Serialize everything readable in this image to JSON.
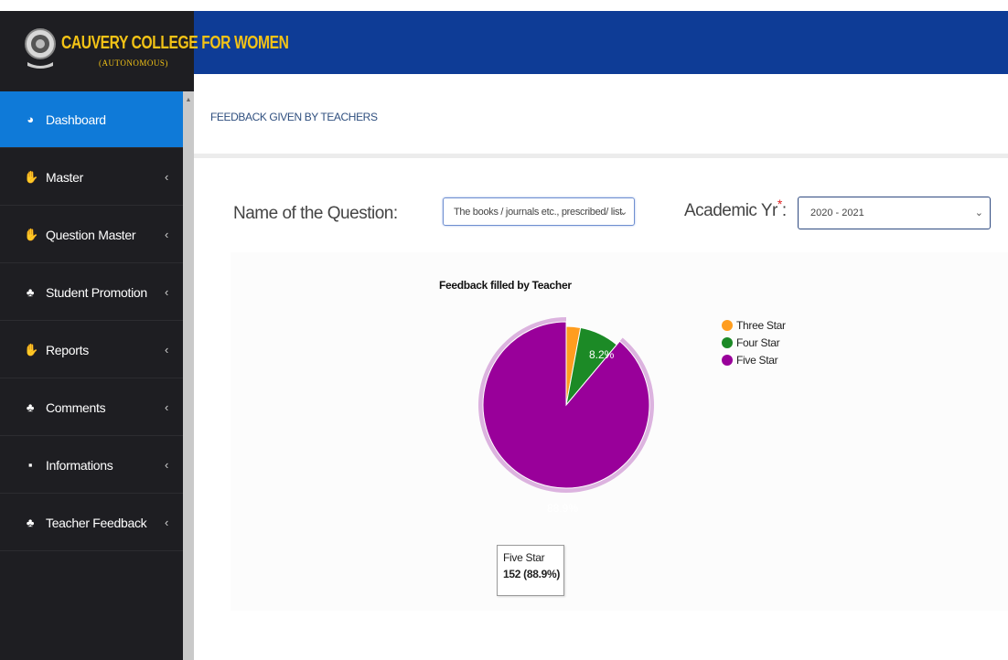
{
  "header": {
    "college_name": "CAUVERY COLLEGE FOR WOMEN",
    "subtitle": "(AUTONOMOUS)",
    "brand_color": "#0e3c96",
    "title_color": "#f3c316"
  },
  "sidebar": {
    "items": [
      {
        "label": "Dashboard",
        "icon": "dashboard-icon",
        "active": true
      },
      {
        "label": "Master",
        "icon": "hand-icon"
      },
      {
        "label": "Question Master",
        "icon": "hand-icon"
      },
      {
        "label": "Student Promotion",
        "icon": "sitemap-icon"
      },
      {
        "label": "Reports",
        "icon": "hand-icon"
      },
      {
        "label": "Comments",
        "icon": "sitemap-icon"
      },
      {
        "label": "Informations",
        "icon": "book-icon"
      },
      {
        "label": "Teacher Feedback",
        "icon": "sitemap-icon"
      }
    ],
    "active_color": "#0f7ad8"
  },
  "page": {
    "title": "FEEDBACK GIVEN BY TEACHERS"
  },
  "filters": {
    "question_label": "Name of the Question:",
    "question_value": "The books / journals etc., prescribed/ list",
    "year_label": "Academic Yr",
    "year_required_mark": "*",
    "year_colon": ":",
    "year_value": "2020 - 2021"
  },
  "chart_data": {
    "type": "pie",
    "title": "Feedback filled by Teacher",
    "series": [
      {
        "name": "Three Star",
        "value": 5,
        "percent": "2.9%",
        "color": "#ff9d1f"
      },
      {
        "name": "Four Star",
        "value": 14,
        "percent": "8.2%",
        "color": "#1c8a26"
      },
      {
        "name": "Five Star",
        "value": 152,
        "percent": "88.9%",
        "color": "#99009a"
      }
    ],
    "slice_labels": [
      "8.2%",
      "88.9%"
    ],
    "legend_position": "right",
    "tooltip": {
      "name": "Five Star",
      "value_text": "152 (88.9%)"
    }
  }
}
